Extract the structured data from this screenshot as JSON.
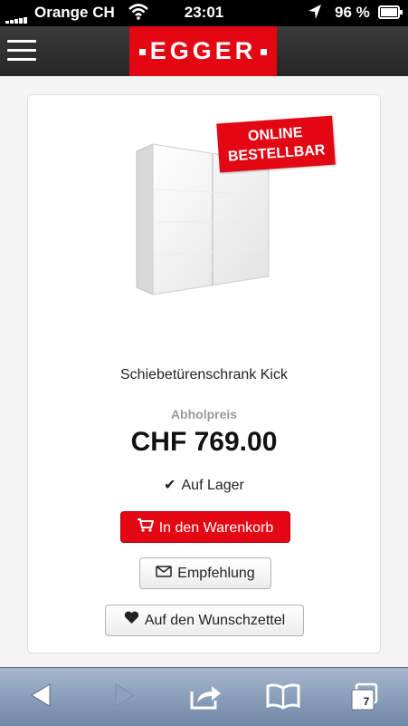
{
  "status_bar": {
    "carrier": "Orange CH",
    "time": "23:01",
    "battery": "96 %"
  },
  "header": {
    "logo": "EGGER",
    "menu_icon": "hamburger-menu-icon"
  },
  "product": {
    "badge_line1": "ONLINE",
    "badge_line2": "BESTELLBAR",
    "name": "Schiebetürenschrank Kick",
    "price_label": "Abholpreis",
    "price": "CHF 769.00",
    "stock": "Auf Lager",
    "add_to_cart": "In den Warenkorb",
    "recommend": "Empfehlung",
    "wishlist": "Auf den Wunschzettel"
  },
  "toolbar": {
    "tabs_count": "7",
    "icons": [
      "back-arrow-icon",
      "forward-arrow-icon",
      "share-icon",
      "bookmarks-icon",
      "tabs-icon"
    ]
  },
  "colors": {
    "brand_red": "#e30613",
    "toolbar_blue": "#8a9fba"
  }
}
